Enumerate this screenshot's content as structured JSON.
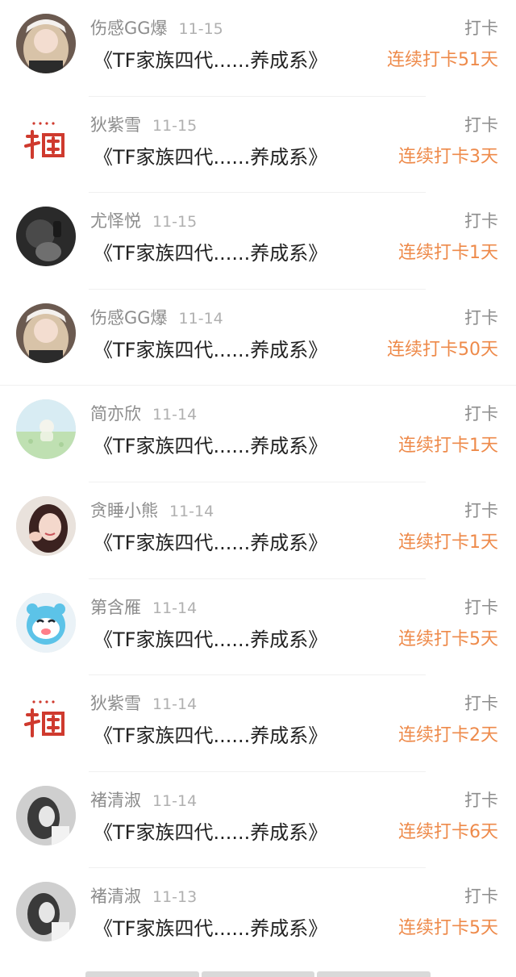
{
  "feed": {
    "items": [
      {
        "avatar": "girl-portrait-avatar",
        "username": "伤感GG爆",
        "date": "11-15",
        "title": "《TF家族四代......养成系》",
        "action": "打卡",
        "streak": "连续打卡51天"
      },
      {
        "avatar": "red-logo-avatar",
        "username": "狄紫雪",
        "date": "11-15",
        "title": "《TF家族四代......养成系》",
        "action": "打卡",
        "streak": "连续打卡3天"
      },
      {
        "avatar": "dark-photo-avatar",
        "username": "尤怿悦",
        "date": "11-15",
        "title": "《TF家族四代......养成系》",
        "action": "打卡",
        "streak": "连续打卡1天"
      },
      {
        "avatar": "girl-portrait-avatar",
        "username": "伤感GG爆",
        "date": "11-14",
        "title": "《TF家族四代......养成系》",
        "action": "打卡",
        "streak": "连续打卡50天"
      },
      {
        "avatar": "pastel-illustration-avatar",
        "username": "简亦欣",
        "date": "11-14",
        "title": "《TF家族四代......养成系》",
        "action": "打卡",
        "streak": "连续打卡1天"
      },
      {
        "avatar": "girl-selfie-avatar",
        "username": "贪睡小熊",
        "date": "11-14",
        "title": "《TF家族四代......养成系》",
        "action": "打卡",
        "streak": "连续打卡1天"
      },
      {
        "avatar": "blue-cartoon-avatar",
        "username": "第含雁",
        "date": "11-14",
        "title": "《TF家族四代......养成系》",
        "action": "打卡",
        "streak": "连续打卡5天"
      },
      {
        "avatar": "red-logo-avatar",
        "username": "狄紫雪",
        "date": "11-14",
        "title": "《TF家族四代......养成系》",
        "action": "打卡",
        "streak": "连续打卡2天"
      },
      {
        "avatar": "grayscale-photo-avatar",
        "username": "褚清淑",
        "date": "11-14",
        "title": "《TF家族四代......养成系》",
        "action": "打卡",
        "streak": "连续打卡6天"
      },
      {
        "avatar": "grayscale-photo-avatar",
        "username": "褚清淑",
        "date": "11-13",
        "title": "《TF家族四代......养成系》",
        "action": "打卡",
        "streak": "连续打卡5天"
      }
    ]
  },
  "colors": {
    "streak": "#ee8a4a",
    "username": "#8c8c8c",
    "title": "#222222"
  }
}
